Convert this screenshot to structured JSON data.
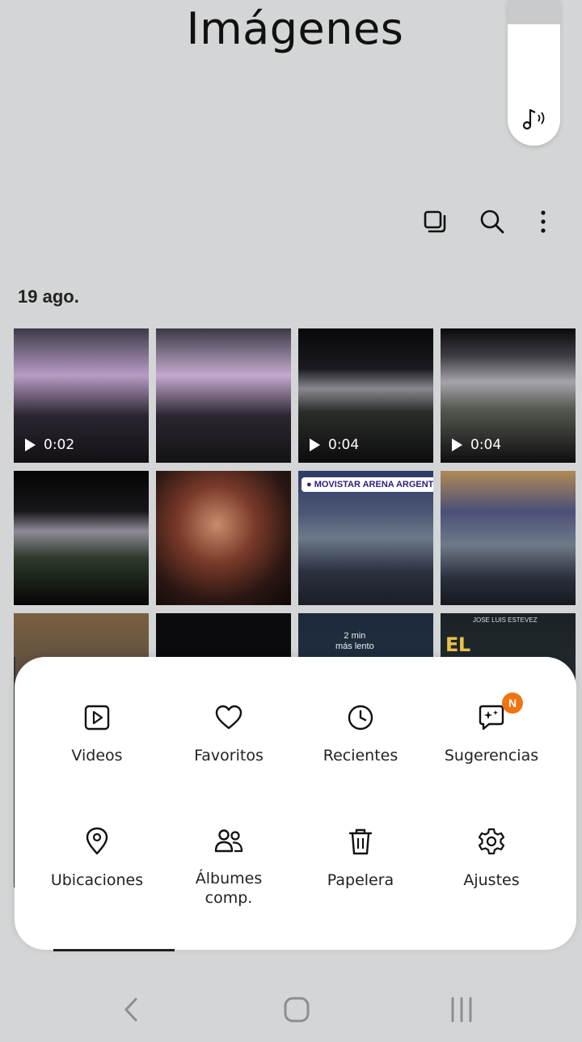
{
  "header": {
    "title": "Imágenes"
  },
  "volume_panel": {
    "icon": "music-note-sound-icon"
  },
  "toolbar": {
    "icons": [
      "select-multiple-icon",
      "search-icon",
      "more-options-icon"
    ]
  },
  "section": {
    "date": "19 ago."
  },
  "photos": [
    {
      "type": "video",
      "duration": "0:02"
    },
    {
      "type": "image"
    },
    {
      "type": "video",
      "duration": "0:04"
    },
    {
      "type": "video",
      "duration": "0:04"
    },
    {
      "type": "image"
    },
    {
      "type": "image"
    },
    {
      "type": "image",
      "location_tag": "MOVISTAR ARENA ARGENTINA"
    },
    {
      "type": "image"
    },
    {
      "type": "image"
    },
    {
      "type": "image"
    },
    {
      "type": "image",
      "map_text": "2 min\nmás lento"
    },
    {
      "type": "image",
      "poster_small": "JOSE LUIS ESTEVEZ",
      "poster_text": "EL SEGUNDO\nPODO"
    }
  ],
  "menu": {
    "items": [
      {
        "label": "Videos",
        "icon": "video-play-icon"
      },
      {
        "label": "Favoritos",
        "icon": "heart-icon"
      },
      {
        "label": "Recientes",
        "icon": "clock-icon"
      },
      {
        "label": "Sugerencias",
        "icon": "suggestions-sparkle-icon",
        "badge": "N"
      },
      {
        "label": "Ubicaciones",
        "icon": "location-pin-icon"
      },
      {
        "label": "Álbumes\ncomp.",
        "icon": "shared-people-icon"
      },
      {
        "label": "Papelera",
        "icon": "trash-icon"
      },
      {
        "label": "Ajustes",
        "icon": "gear-icon"
      }
    ]
  },
  "navbar": {
    "icons": [
      "back-icon",
      "home-icon",
      "recent-apps-icon"
    ]
  },
  "colors": {
    "badge": "#f07410",
    "background": "#d3d5d6",
    "sheet": "#ffffff"
  }
}
